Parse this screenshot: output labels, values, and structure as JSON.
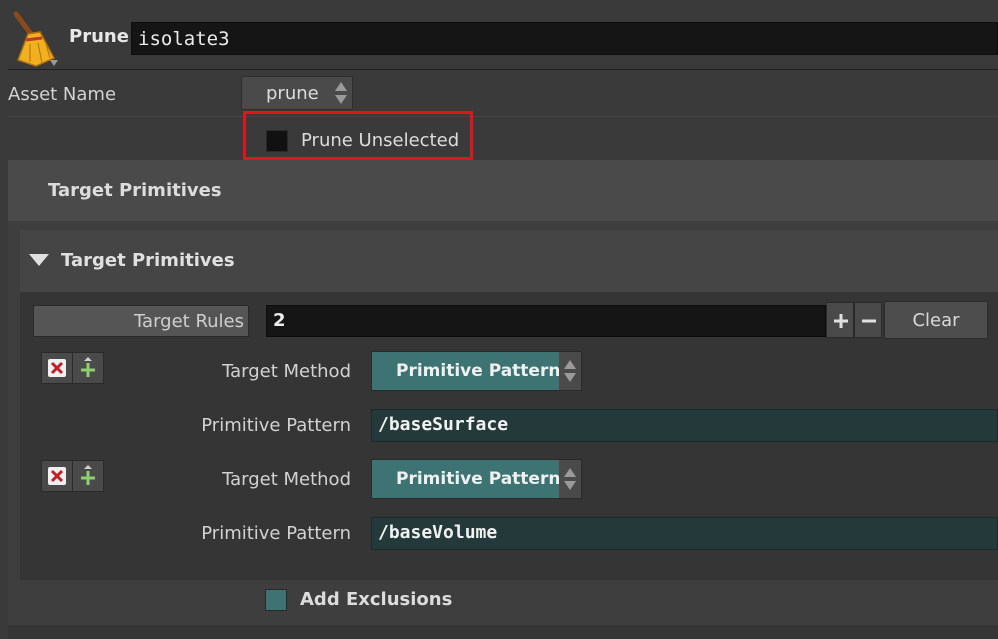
{
  "header": {
    "node_type": "Prune",
    "node_name": "isolate3",
    "icon": "broom-icon"
  },
  "asset": {
    "label": "Asset Name",
    "value": "prune"
  },
  "prune_unselected": {
    "label": "Prune Unselected",
    "checked": false
  },
  "folder_tab": {
    "label": "Target Primitives"
  },
  "section": {
    "title": "Target Primitives",
    "expanded": true
  },
  "rules": {
    "label": "Target Rules",
    "count": "2",
    "clear_label": "Clear"
  },
  "entries": [
    {
      "method_label": "Target Method",
      "method_value": "Primitive Pattern",
      "pattern_label": "Primitive Pattern",
      "pattern_value": "/baseSurface"
    },
    {
      "method_label": "Target Method",
      "method_value": "Primitive Pattern",
      "pattern_label": "Primitive Pattern",
      "pattern_value": "/baseVolume"
    }
  ],
  "exclusions": {
    "label": "Add Exclusions",
    "checked": true
  },
  "colors": {
    "accent_teal": "#3d7373",
    "highlight_red": "#e0141c"
  }
}
